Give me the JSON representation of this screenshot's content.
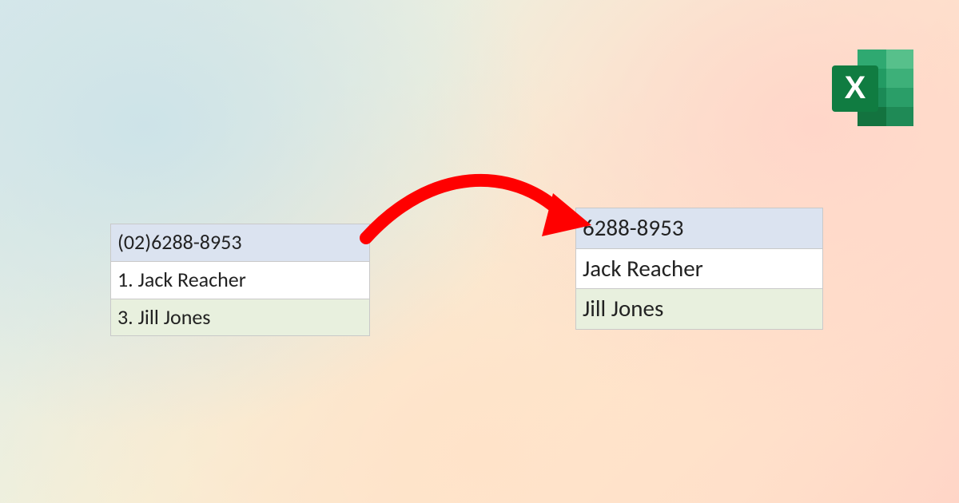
{
  "left_table": {
    "rows": [
      "(02)6288-8953",
      "1. Jack Reacher",
      "3. Jill Jones"
    ]
  },
  "right_table": {
    "rows": [
      "6288-8953",
      "Jack Reacher",
      "Jill Jones"
    ]
  },
  "icon": {
    "letter": "X"
  }
}
